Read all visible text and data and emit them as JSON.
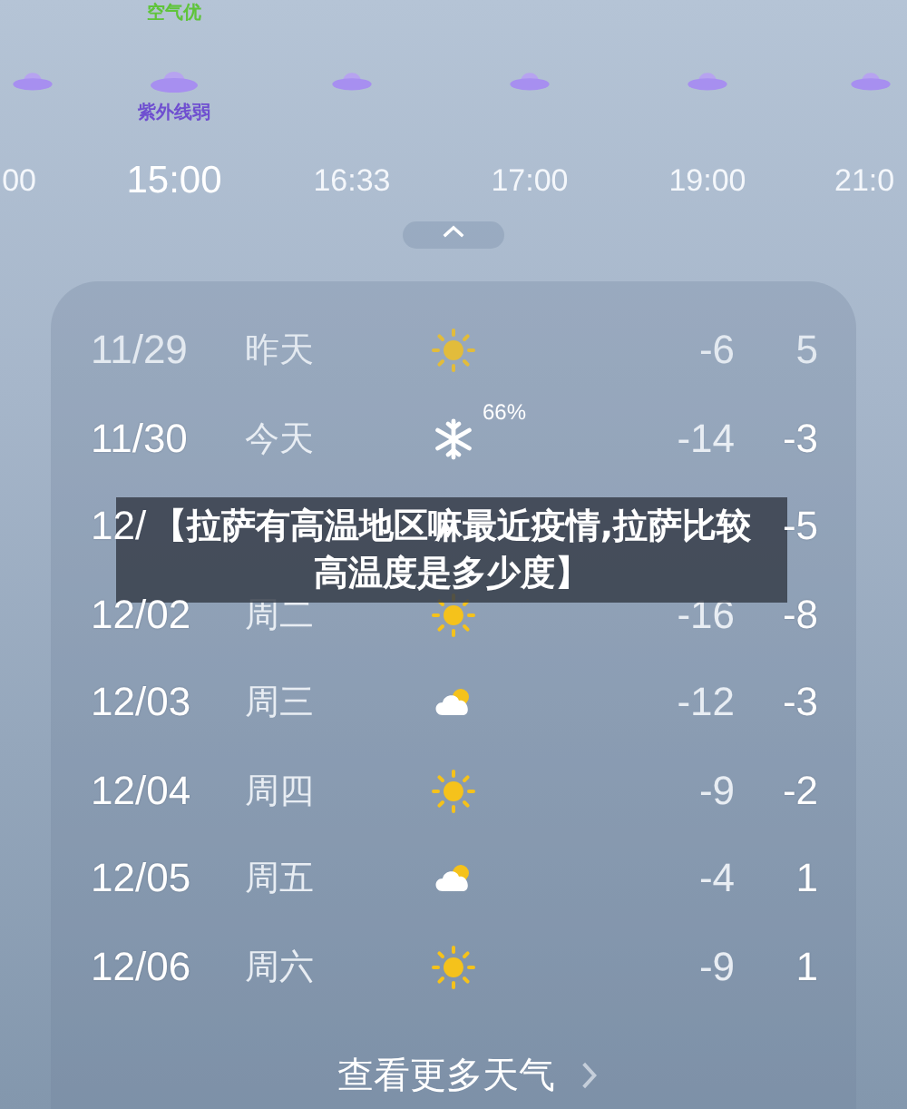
{
  "hourly": [
    {
      "time": "00",
      "selected": false
    },
    {
      "time": "15:00",
      "selected": true,
      "air": "空气优",
      "uv": "紫外线弱"
    },
    {
      "time": "16:33",
      "selected": false
    },
    {
      "time": "17:00",
      "selected": false
    },
    {
      "time": "19:00",
      "selected": false
    },
    {
      "time": "21:0",
      "selected": false
    }
  ],
  "forecast": [
    {
      "date": "11/29",
      "weekday": "昨天",
      "kind": "sun",
      "low": "-6",
      "high": "5",
      "past": true
    },
    {
      "date": "11/30",
      "weekday": "今天",
      "kind": "snow",
      "precip": "66%",
      "low": "-14",
      "high": "-3",
      "past": false
    },
    {
      "date": "12/",
      "high": "-5",
      "past": false
    },
    {
      "date": "12/02",
      "weekday": "周二",
      "kind": "sun",
      "low": "-16",
      "high": "-8",
      "past": false
    },
    {
      "date": "12/03",
      "weekday": "周三",
      "kind": "cloud",
      "low": "-12",
      "high": "-3",
      "past": false
    },
    {
      "date": "12/04",
      "weekday": "周四",
      "kind": "sun",
      "low": "-9",
      "high": "-2",
      "past": false
    },
    {
      "date": "12/05",
      "weekday": "周五",
      "kind": "cloud",
      "low": "-4",
      "high": "1",
      "past": false
    },
    {
      "date": "12/06",
      "weekday": "周六",
      "kind": "sun",
      "low": "-9",
      "high": "1",
      "past": false
    }
  ],
  "more_link": "查看更多天气",
  "banner": "【拉萨有高温地区嘛最近疫情,拉萨比较高温度是多少度】"
}
